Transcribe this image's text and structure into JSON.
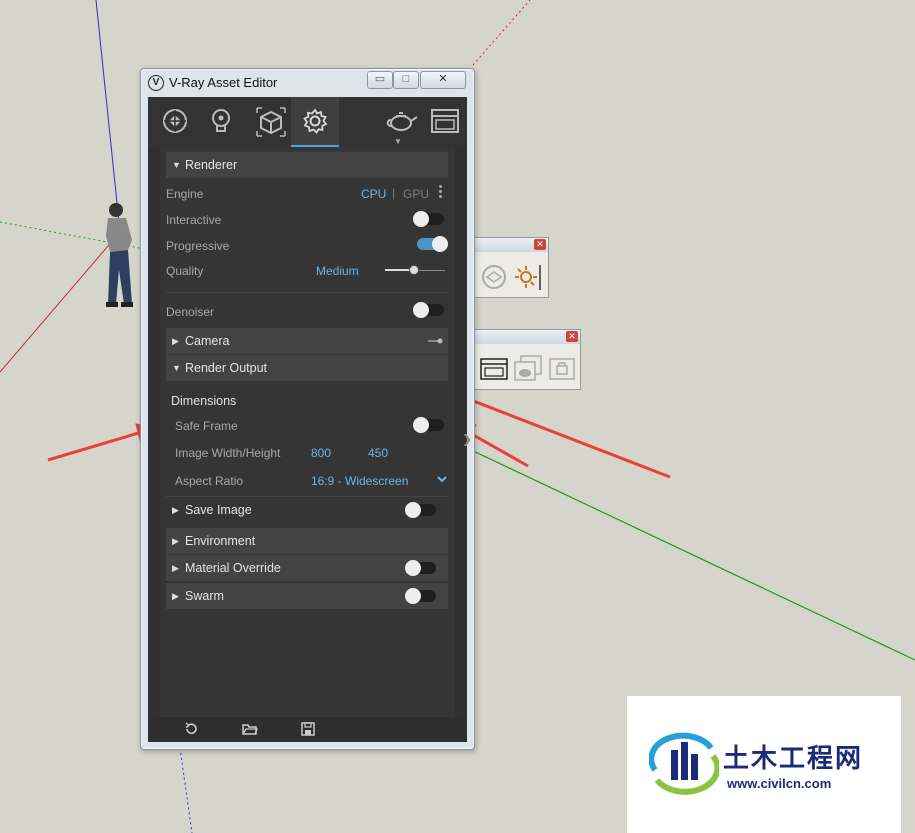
{
  "window": {
    "title": "V-Ray Asset Editor",
    "minimize_glyph": "▭",
    "maximize_glyph": "□",
    "close_glyph": "✕"
  },
  "tabs": [
    {
      "name": "materials",
      "icon": "material-sphere-icon"
    },
    {
      "name": "lights",
      "icon": "light-bulb-icon"
    },
    {
      "name": "geometry",
      "icon": "cube-icon"
    },
    {
      "name": "settings",
      "icon": "gear-icon",
      "active": true
    },
    {
      "name": "render",
      "icon": "teapot-icon"
    },
    {
      "name": "frame-buffer",
      "icon": "frame-buffer-icon"
    }
  ],
  "renderer": {
    "header": "Renderer",
    "engine_label": "Engine",
    "engine_cpu": "CPU",
    "engine_sep": "|",
    "engine_gpu": "GPU",
    "interactive_label": "Interactive",
    "interactive_on": false,
    "progressive_label": "Progressive",
    "progressive_on": true,
    "quality_label": "Quality",
    "quality_value": "Medium",
    "denoiser_label": "Denoiser",
    "denoiser_on": false
  },
  "camera": {
    "header": "Camera"
  },
  "render_output": {
    "header": "Render Output",
    "dimensions_label": "Dimensions",
    "safe_frame_label": "Safe Frame",
    "safe_frame_on": false,
    "image_size_label": "Image Width/Height",
    "width": "800",
    "height": "450",
    "aspect_label": "Aspect Ratio",
    "aspect_value": "16:9 - Widescreen"
  },
  "save_image": {
    "header": "Save Image"
  },
  "environment": {
    "header": "Environment"
  },
  "material_override": {
    "header": "Material Override"
  },
  "swarm": {
    "header": "Swarm"
  },
  "bottom_bar": [
    "reset-icon",
    "open-folder-icon",
    "save-icon"
  ],
  "watermark": {
    "text": "土木工程网",
    "url": "www.civilcn.com"
  },
  "colors": {
    "accent": "#4aa3df",
    "value_blue": "#6fb4e4",
    "arrow_red": "#e8403a"
  }
}
